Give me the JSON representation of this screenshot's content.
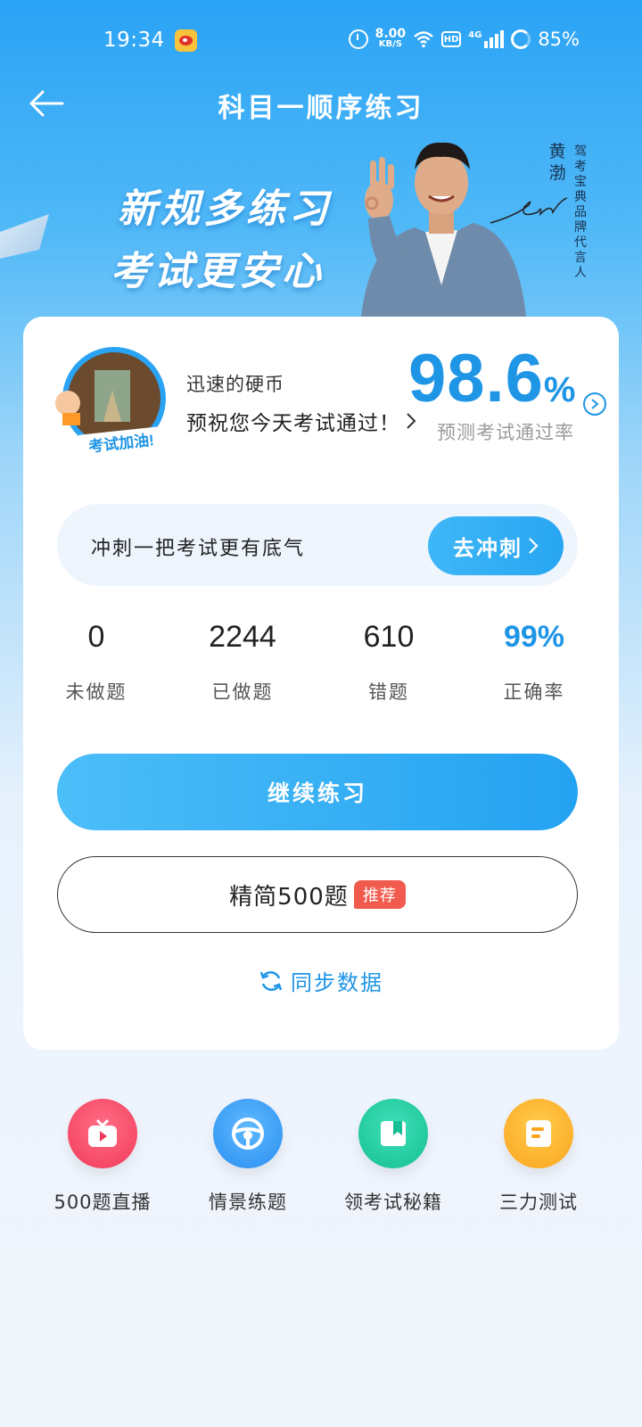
{
  "status_bar": {
    "time": "19:34",
    "net_speed": "8.00",
    "net_speed_unit": "KB/S",
    "hd": "HD",
    "network": "4G",
    "battery": "85%"
  },
  "header": {
    "title": "科目一顺序练习"
  },
  "banner": {
    "slogan_line1": "新规多练习",
    "slogan_line2": "考试更安心",
    "endorser_name": "黄渤",
    "endorser_title": "驾考宝典品牌代言人"
  },
  "profile": {
    "avatar_badge": "考试加油!",
    "username": "迅速的硬币",
    "wish": "预祝您今天考试通过！",
    "pass_rate_value": "98.6",
    "pass_rate_unit": "%",
    "pass_rate_label": "预测考试通过率"
  },
  "sprint": {
    "text": "冲刺一把考试更有底气",
    "button": "去冲刺"
  },
  "stats": [
    {
      "value": "0",
      "label": "未做题"
    },
    {
      "value": "2244",
      "label": "已做题"
    },
    {
      "value": "610",
      "label": "错题"
    },
    {
      "value": "99%",
      "label": "正确率"
    }
  ],
  "actions": {
    "continue": "继续练习",
    "simplified": "精简500题",
    "simplified_tag": "推荐",
    "sync": "同步数据"
  },
  "shortcuts": [
    {
      "label": "500题直播",
      "icon": "tv-play-icon",
      "color": "#f2395a"
    },
    {
      "label": "情景练题",
      "icon": "steering-wheel-icon",
      "color": "#2a8ff0"
    },
    {
      "label": "领考试秘籍",
      "icon": "book-icon",
      "color": "#16bf92"
    },
    {
      "label": "三力测试",
      "icon": "test-sheet-icon",
      "color": "#fba51d"
    }
  ]
}
